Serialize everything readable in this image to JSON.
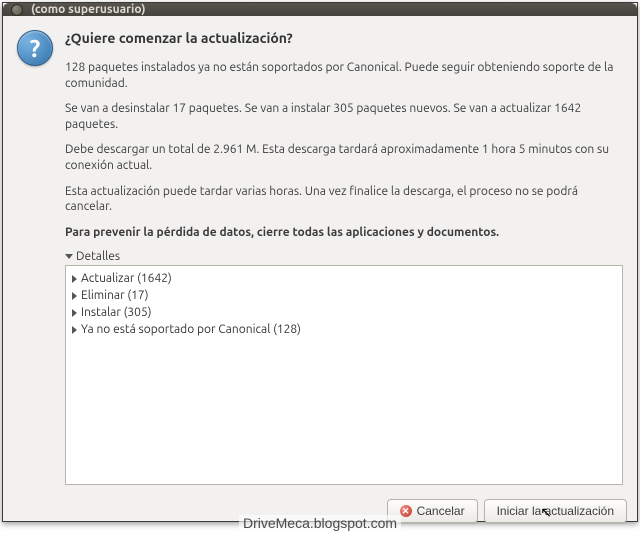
{
  "window": {
    "title": "(como superusuario)"
  },
  "icon": {
    "glyph": "?"
  },
  "heading": "¿Quiere comenzar la actualización?",
  "paragraphs": {
    "p1": "128 paquetes instalados ya no están soportados por Canonical. Puede seguir obteniendo soporte de la comunidad.",
    "p2": "Se van a desinstalar 17 paquetes. Se van a instalar 305 paquetes nuevos. Se van a actualizar 1642 paquetes.",
    "p3": "Debe descargar un total de 2.961 M. Esta descarga tardará aproximadamente 1 hora 5 minutos con su conexión actual.",
    "p4": "Esta actualización puede tardar varias horas. Una vez finalice la descarga, el proceso no se podrá cancelar.",
    "p5": "Para prevenir la pérdida de datos, cierre todas las aplicaciones y documentos."
  },
  "details": {
    "label": "Detalles",
    "items": [
      {
        "label": "Actualizar (1642)"
      },
      {
        "label": "Eliminar (17)"
      },
      {
        "label": "Instalar (305)"
      },
      {
        "label": "Ya no está soportado por Canonical (128)"
      }
    ]
  },
  "buttons": {
    "cancel": "Cancelar",
    "start": "Iniciar la actualización"
  },
  "watermark": "DriveMeca.blogspot.com"
}
